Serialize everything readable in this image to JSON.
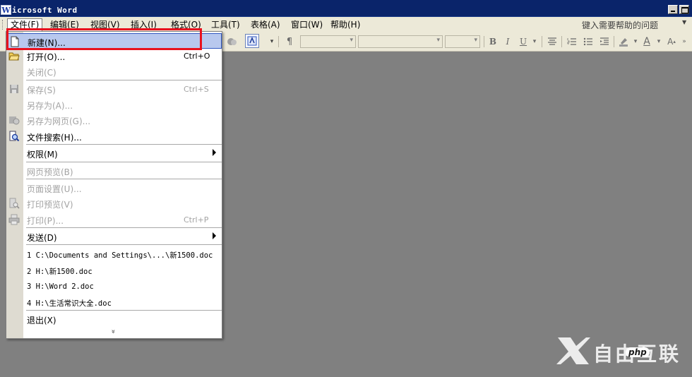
{
  "window": {
    "title": "Microsoft Word",
    "title_rest": "icrosoft Word",
    "logo_letter": "W"
  },
  "menubar": {
    "items": [
      {
        "label": "文件(F)",
        "open": true
      },
      {
        "label": "编辑(E)"
      },
      {
        "label": "视图(V)"
      },
      {
        "label": "插入(I)"
      },
      {
        "label": "格式(O)"
      },
      {
        "label": "工具(T)"
      },
      {
        "label": "表格(A)"
      },
      {
        "label": "窗口(W)"
      },
      {
        "label": "帮助(H)"
      }
    ],
    "help_placeholder": "键入需要帮助的问题"
  },
  "toolbar": {
    "buttons": [
      "B",
      "I",
      "U",
      "A"
    ]
  },
  "file_menu": {
    "items": [
      {
        "label": "新建(N)...",
        "shortcut": "",
        "disabled": false,
        "icon": "new-document-icon"
      },
      {
        "label": "打开(O)...",
        "shortcut": "Ctrl+O",
        "disabled": false,
        "icon": "open-folder-icon"
      },
      {
        "label": "关闭(C)",
        "shortcut": "",
        "disabled": true,
        "icon": ""
      },
      {
        "label": "保存(S)",
        "shortcut": "Ctrl+S",
        "disabled": true,
        "icon": "save-icon"
      },
      {
        "label": "另存为(A)...",
        "shortcut": "",
        "disabled": true,
        "icon": ""
      },
      {
        "label": "另存为网页(G)...",
        "shortcut": "",
        "disabled": true,
        "icon": "save-as-web-icon"
      },
      {
        "label": "文件搜索(H)...",
        "shortcut": "",
        "disabled": false,
        "icon": "file-search-icon"
      },
      {
        "label": "权限(M)",
        "shortcut": "",
        "disabled": false,
        "icon": "",
        "submenu": true
      },
      {
        "label": "网页预览(B)",
        "shortcut": "",
        "disabled": true,
        "icon": ""
      },
      {
        "label": "页面设置(U)...",
        "shortcut": "",
        "disabled": true,
        "icon": ""
      },
      {
        "label": "打印预览(V)",
        "shortcut": "",
        "disabled": true,
        "icon": "print-preview-icon"
      },
      {
        "label": "打印(P)...",
        "shortcut": "Ctrl+P",
        "disabled": true,
        "icon": "print-icon"
      },
      {
        "label": "发送(D)",
        "shortcut": "",
        "disabled": false,
        "icon": "",
        "submenu": true
      }
    ],
    "recent_files": [
      "1 C:\\Documents and Settings\\...\\新1500.doc",
      "2 H:\\新1500.doc",
      "3 H:\\Word 2.doc",
      "4 H:\\生活常识大全.doc"
    ],
    "exit_label": "退出(X)",
    "expand_glyph": "»"
  },
  "watermark": {
    "text": "自由互联",
    "badge": "php"
  },
  "colors": {
    "title_bar": "#0a246a",
    "menu_bg": "#ece9d8",
    "workspace": "#808080",
    "highlight": "#b8c8ee",
    "callout_red": "#e8121e"
  }
}
